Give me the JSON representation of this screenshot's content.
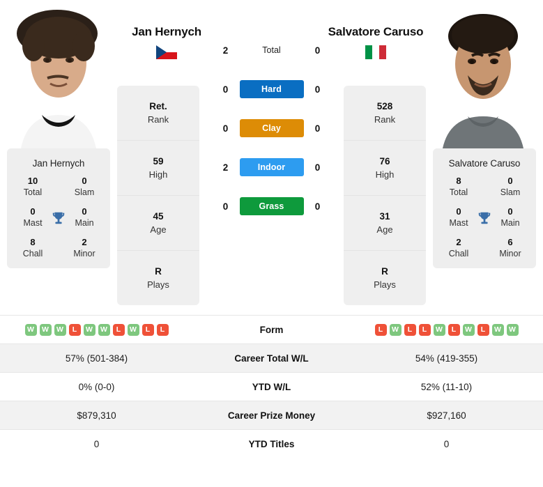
{
  "players": {
    "left": {
      "name": "Jan Hernych",
      "flag": "czech-republic-flag",
      "photo_alt": "jan-hernych-photo",
      "rank": "Ret.",
      "rank_label": "Rank",
      "high": "59",
      "high_label": "High",
      "age": "45",
      "age_label": "Age",
      "plays": "R",
      "plays_label": "Plays",
      "titles": {
        "total": "10",
        "total_label": "Total",
        "slam": "0",
        "slam_label": "Slam",
        "mast": "0",
        "mast_label": "Mast",
        "main": "0",
        "main_label": "Main",
        "chall": "8",
        "chall_label": "Chall",
        "minor": "2",
        "minor_label": "Minor"
      },
      "form": [
        "W",
        "W",
        "W",
        "L",
        "W",
        "W",
        "L",
        "W",
        "L",
        "L"
      ],
      "career_total_wl": "57% (501-384)",
      "ytd_wl": "0% (0-0)",
      "career_prize_money": "$879,310",
      "ytd_titles": "0"
    },
    "right": {
      "name": "Salvatore Caruso",
      "flag": "italy-flag",
      "photo_alt": "salvatore-caruso-photo",
      "rank": "528",
      "rank_label": "Rank",
      "high": "76",
      "high_label": "High",
      "age": "31",
      "age_label": "Age",
      "plays": "R",
      "plays_label": "Plays",
      "titles": {
        "total": "8",
        "total_label": "Total",
        "slam": "0",
        "slam_label": "Slam",
        "mast": "0",
        "mast_label": "Mast",
        "main": "0",
        "main_label": "Main",
        "chall": "2",
        "chall_label": "Chall",
        "minor": "6",
        "minor_label": "Minor"
      },
      "form": [
        "L",
        "W",
        "L",
        "L",
        "W",
        "L",
        "W",
        "L",
        "W",
        "W"
      ],
      "career_total_wl": "54% (419-355)",
      "ytd_wl": "52% (11-10)",
      "career_prize_money": "$927,160",
      "ytd_titles": "0"
    }
  },
  "h2h": {
    "rows": [
      {
        "label": "Total",
        "left": "2",
        "right": "0",
        "type": "total",
        "color": ""
      },
      {
        "label": "Hard",
        "left": "0",
        "right": "0",
        "type": "surface",
        "color": "#0a6ec2"
      },
      {
        "label": "Clay",
        "left": "0",
        "right": "0",
        "type": "surface",
        "color": "#dd8c06"
      },
      {
        "label": "Indoor",
        "left": "2",
        "right": "0",
        "type": "surface",
        "color": "#2d9cf0"
      },
      {
        "label": "Grass",
        "left": "0",
        "right": "0",
        "type": "surface",
        "color": "#0e9a3c"
      }
    ]
  },
  "table": {
    "rows": [
      {
        "label": "Form",
        "type": "form"
      },
      {
        "label": "Career Total W/L",
        "type": "text",
        "key": "career_total_wl"
      },
      {
        "label": "YTD W/L",
        "type": "text",
        "key": "ytd_wl"
      },
      {
        "label": "Career Prize Money",
        "type": "text",
        "key": "career_prize_money"
      },
      {
        "label": "YTD Titles",
        "type": "text",
        "key": "ytd_titles"
      }
    ]
  },
  "colors": {
    "win": "#7ec77e",
    "loss": "#ef5138",
    "trophy": "#3a6ea8",
    "card_bg": "#eeeeee",
    "row_alt": "#f2f2f2"
  }
}
